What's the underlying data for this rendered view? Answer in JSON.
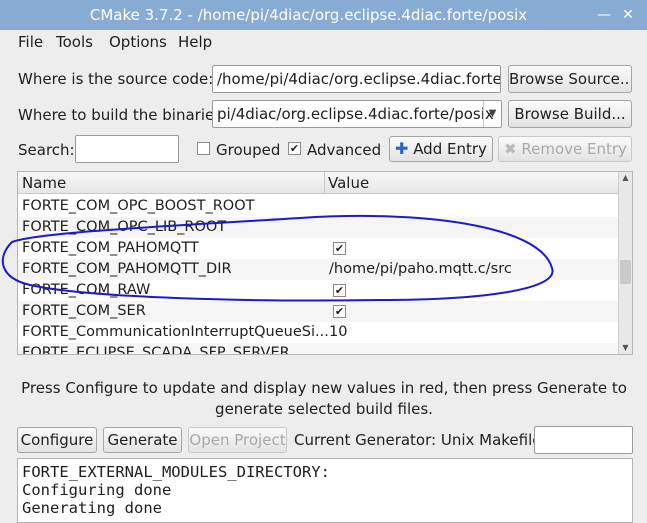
{
  "window": {
    "title": "CMake 3.7.2 - /home/pi/4diac/org.eclipse.4diac.forte/posix",
    "minimize": "—",
    "close": "✕"
  },
  "menu": [
    "File",
    "Tools",
    "Options",
    "Help"
  ],
  "source": {
    "label": "Where is the source code:",
    "value": "/home/pi/4diac/org.eclipse.4diac.forte",
    "browse": "Browse Source..."
  },
  "build": {
    "label": "Where to build the binaries:",
    "value": "pi/4diac/org.eclipse.4diac.forte/posix",
    "browse": "Browse Build..."
  },
  "search": {
    "label": "Search:",
    "value": ""
  },
  "options": {
    "grouped": {
      "label": "Grouped",
      "checked": false
    },
    "advanced": {
      "label": "Advanced",
      "checked": true
    },
    "add_entry": "Add Entry",
    "remove_entry": "Remove Entry"
  },
  "table": {
    "headers": [
      "Name",
      "Value"
    ],
    "rows": [
      {
        "name": "FORTE_COM_OPC_BOOST_ROOT",
        "value": "",
        "checkbox": false
      },
      {
        "name": "FORTE_COM_OPC_LIB_ROOT",
        "value": "",
        "checkbox": false
      },
      {
        "name": "FORTE_COM_PAHOMQTT",
        "value": "✔",
        "checkbox": true
      },
      {
        "name": "FORTE_COM_PAHOMQTT_DIR",
        "value": "/home/pi/paho.mqtt.c/src",
        "checkbox": false
      },
      {
        "name": "FORTE_COM_RAW",
        "value": "✔",
        "checkbox": true
      },
      {
        "name": "FORTE_COM_SER",
        "value": "✔",
        "checkbox": true
      },
      {
        "name": "FORTE_CommunicationInterruptQueueSi...",
        "value": "10",
        "checkbox": false
      },
      {
        "name": "FORTE_ECLIPSE_SCADA_SFP_SERVER",
        "value": "",
        "checkbox": false
      }
    ]
  },
  "hint": "Press Configure to update and display new values in red, then press Generate to generate selected build files.",
  "actions": {
    "configure": "Configure",
    "generate": "Generate",
    "open_project": "Open Project",
    "generator_label": "Current Generator: Unix Makefiles",
    "generator_value": ""
  },
  "output": [
    "FORTE_EXTERNAL_MODULES_DIRECTORY:",
    "Configuring done",
    "Generating done"
  ],
  "colors": {
    "titlebar": "#87abd3",
    "annotation": "#1a1acf"
  }
}
